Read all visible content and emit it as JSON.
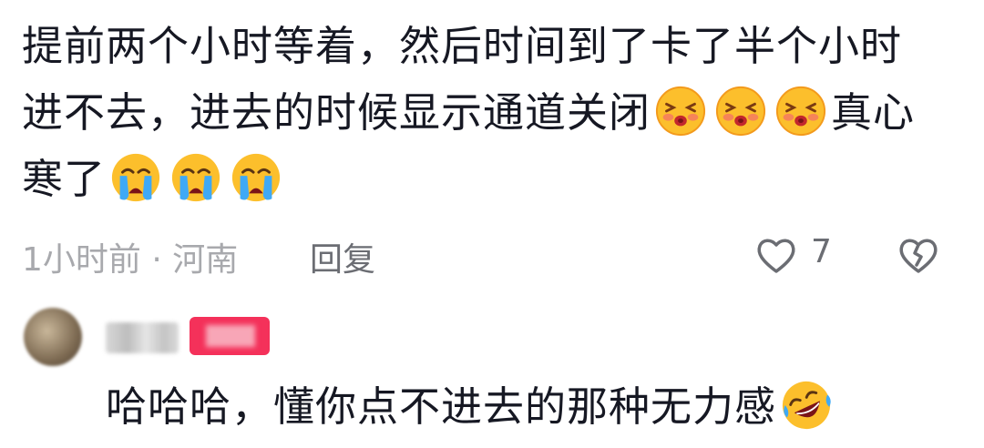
{
  "comment": {
    "line1": "提前两个小时等着，然后时间到了卡了半个小时",
    "line2_a": "进不去，进去的时候显示通道关闭",
    "line2_b": "真心",
    "line3": "寒了",
    "emoji_line2": "kissing-face-emoji",
    "emoji_line3": "loudly-crying-face-emoji"
  },
  "meta": {
    "time_location": "1小时前 · 河南",
    "reply_label": "回复",
    "like_count": "7"
  },
  "reply": {
    "text": "哈哈哈，懂你点不进去的那种无力感",
    "emoji": "rolling-on-floor-laughing-emoji"
  },
  "colors": {
    "text": "#161823",
    "meta_gray": "#a8a9ad",
    "action_gray": "#6b6d73",
    "badge": "#f4315a"
  }
}
